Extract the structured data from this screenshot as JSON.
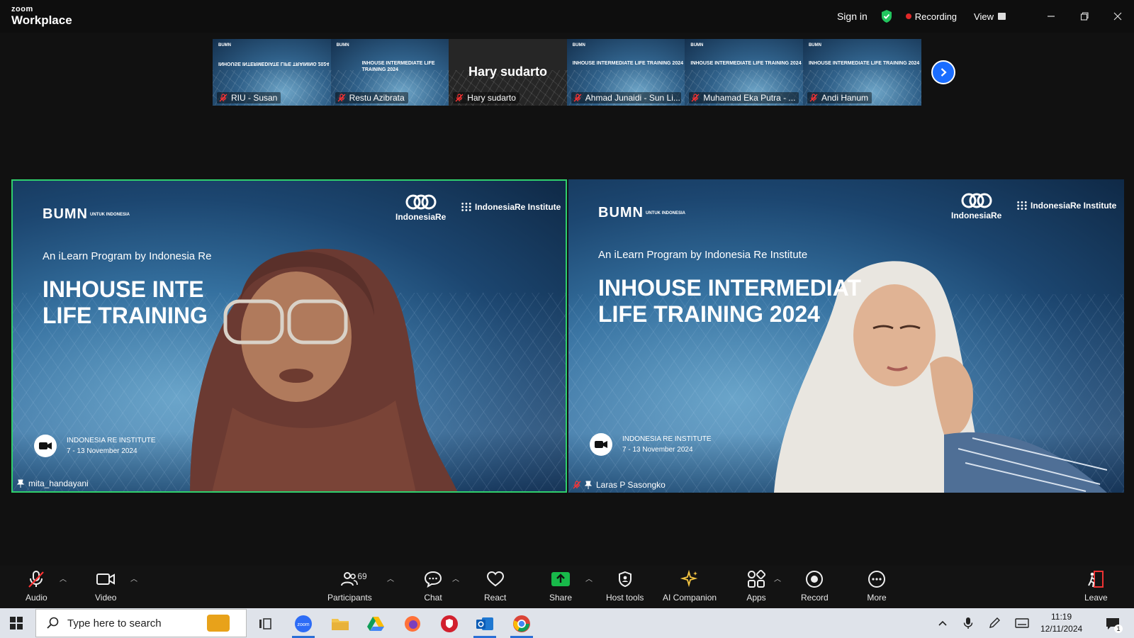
{
  "app": {
    "logo_line1": "zoom",
    "logo_line2": "Workplace",
    "sign_in": "Sign in",
    "recording": "Recording",
    "view": "View"
  },
  "gallery": [
    {
      "name": "RIU - Susan",
      "muted": true,
      "has_video": true
    },
    {
      "name": "Restu Azibrata",
      "muted": true,
      "has_video": true
    },
    {
      "name": "Hary sudarto",
      "muted": true,
      "has_video": false,
      "display_name": "Hary sudarto"
    },
    {
      "name": "Ahmad Junaidi - Sun Li...",
      "muted": true,
      "has_video": true
    },
    {
      "name": "Muhamad Eka Putra - ...",
      "muted": true,
      "has_video": true
    },
    {
      "name": "Andi Hanum",
      "muted": true,
      "has_video": true
    }
  ],
  "slide": {
    "bumn": "BUMN",
    "bumn_sub": "UNTUK INDONESIA",
    "ire": "IndonesiaRe",
    "iri": "IndonesiaRe Institute",
    "mini_title": "INHOUSE INTERMEDIATE LIFE TRAINING 2024",
    "mini_logo": "BUMN",
    "program_left": "An iLearn Program by Indonesia Re",
    "program_right": "An iLearn Program by Indonesia Re Institute",
    "headline_left_1": "INHOUSE INTE",
    "headline_left_2": "LIFE TRAINING",
    "headline_right_1": "INHOUSE INTERMEDIAT",
    "headline_right_2": "LIFE TRAINING 2024",
    "event_org": "INDONESIA RE INSTITUTE",
    "event_date": "7 - 13 November 2024"
  },
  "tiles": [
    {
      "name": "mita_handayani",
      "active_speaker": true,
      "muted": false
    },
    {
      "name": "Laras P Sasongko",
      "active_speaker": false,
      "muted": true
    }
  ],
  "toolbar": {
    "audio": "Audio",
    "video": "Video",
    "participants": "Participants",
    "participants_count": "69",
    "chat": "Chat",
    "react": "React",
    "share": "Share",
    "host_tools": "Host tools",
    "ai_companion": "AI Companion",
    "apps": "Apps",
    "record": "Record",
    "more": "More",
    "leave": "Leave"
  },
  "taskbar": {
    "search_placeholder": "Type here to search",
    "time": "11:19",
    "date": "12/11/2024",
    "notification_count": "1"
  },
  "colors": {
    "active_speaker_border": "#2fcf6d",
    "recording_dot": "#e02828",
    "share_green": "#18b94a",
    "next_button": "#1a6dff",
    "shield_green": "#22c55e"
  }
}
